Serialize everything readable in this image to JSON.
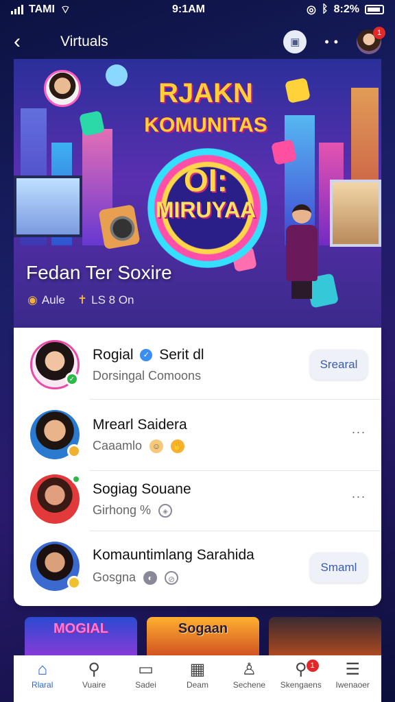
{
  "status_bar": {
    "carrier": "TAMI",
    "time": "9:1AM",
    "battery": "8:2%"
  },
  "header": {
    "title": "Virtuals",
    "notification_count": "1"
  },
  "hero": {
    "title_line1": "RJAKN",
    "title_line2": "KOMUNITAS",
    "badge_line1": "OI:",
    "badge_line2": "MIRUYAA",
    "caption": "Fedan Ter Soxire",
    "meta_left": "Aule",
    "meta_right": "LS 8 On"
  },
  "communities": [
    {
      "name": "Rogial",
      "name_suffix": "Serit dl",
      "subtitle": "Dorsingal Comoons",
      "action": "Srearal"
    },
    {
      "name": "Mrearl Saidera",
      "subtitle": "Caaamlo",
      "action": "..."
    },
    {
      "name": "Sogiag Souane",
      "subtitle": "Girhong %",
      "action": "..."
    },
    {
      "name": "Komauntimlang Sarahida",
      "subtitle": "Gosgna",
      "action": "Smaml"
    }
  ],
  "thumbnails": [
    "MOGIAL",
    "Sogaan",
    ""
  ],
  "tabs": [
    {
      "label": "Rlaral",
      "icon": "home-icon"
    },
    {
      "label": "Vuaire",
      "icon": "search-icon"
    },
    {
      "label": "Sadei",
      "icon": "briefcase-icon"
    },
    {
      "label": "Deam",
      "icon": "calendar-icon"
    },
    {
      "label": "Sechene",
      "icon": "person-icon"
    },
    {
      "label": "Skengaens",
      "icon": "chat-search-icon",
      "badge": "1"
    },
    {
      "label": "Iwenaoer",
      "icon": "menu-icon"
    }
  ],
  "colors": {
    "accent": "#2a64d8",
    "badge": "#e02a2a",
    "online": "#2eb84a"
  }
}
